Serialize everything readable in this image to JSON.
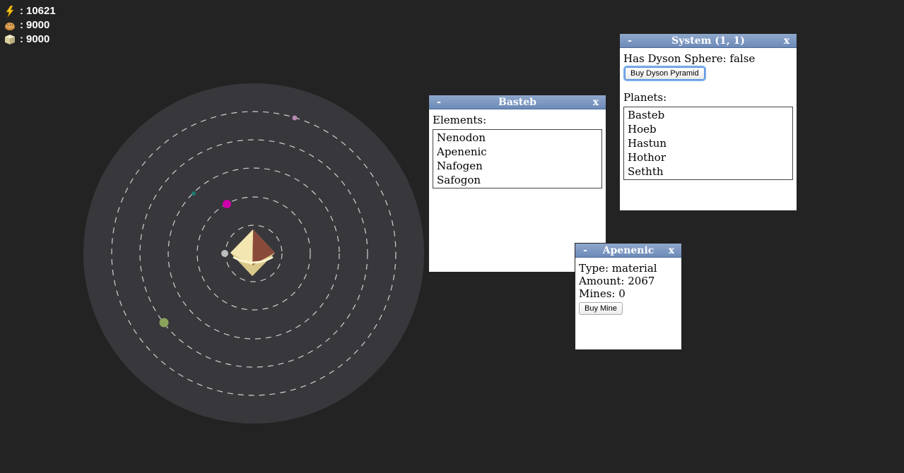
{
  "resources": {
    "energy": {
      "icon": "lightning-icon",
      "value": "10621"
    },
    "food": {
      "icon": "bread-icon",
      "value": "9000"
    },
    "material": {
      "icon": "crate-icon",
      "value": "9000"
    },
    "separator": ":"
  },
  "colors": {
    "background": "#232323",
    "system_disc": "#38373b",
    "orbit": "#d0d0d0",
    "header": "#7a94bf"
  },
  "system_map": {
    "star_icon": "pyramid-star-icon",
    "planets": [
      {
        "name": "Basteb",
        "color": "#bdbdbd"
      },
      {
        "name": "Hoeb",
        "color": "#cc00aa"
      },
      {
        "name": "Hastun",
        "color": "#1e7a6c"
      },
      {
        "name": "Hothor",
        "color": "#8aa35a"
      },
      {
        "name": "Sethth",
        "color": "#b487b0"
      }
    ]
  },
  "system_panel": {
    "title": "System (1, 1)",
    "minimize": "-",
    "close": "x",
    "dyson_label": "Has Dyson Sphere: false",
    "buy_button": "Buy Dyson Pyramid",
    "planets_label": "Planets:",
    "planets": [
      "Basteb",
      "Hoeb",
      "Hastun",
      "Hothor",
      "Sethth"
    ]
  },
  "planet_panel": {
    "title": "Basteb",
    "minimize": "-",
    "close": "x",
    "elements_label": "Elements:",
    "elements": [
      "Nenodon",
      "Apenenic",
      "Nafogen",
      "Safogon"
    ]
  },
  "element_panel": {
    "title": "Apenenic",
    "minimize": "-",
    "close": "x",
    "type": "Type: material",
    "amount": "Amount: 2067",
    "mines": "Mines: 0",
    "buy_button": "Buy Mine"
  }
}
